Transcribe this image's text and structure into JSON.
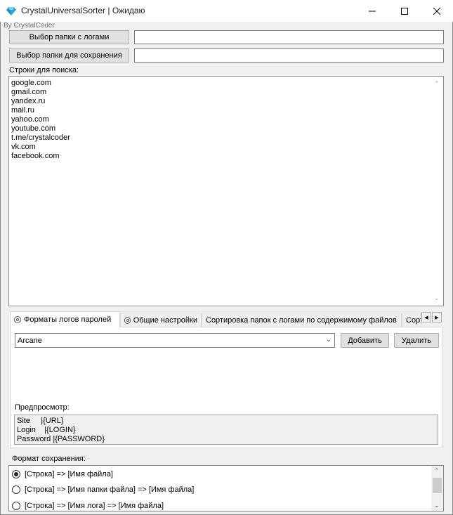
{
  "window": {
    "title": "CrystalUniversalSorter | Ожидаю",
    "minimize_glyph": "—",
    "maximize_glyph": "☐",
    "close_glyph": "✕",
    "icon_color": "#2aa7e0"
  },
  "byline": "By CrystalCoder",
  "folders": {
    "logs_button": "Выбор папки с логами",
    "logs_path": "",
    "save_button": "Выбор папки для сохранения",
    "save_path": ""
  },
  "search": {
    "label": "Строки для поиска:",
    "lines": [
      "google.com",
      "gmail.com",
      "yandex.ru",
      "mail.ru",
      "yahoo.com",
      "youtube.com",
      "t.me/crystalcoder",
      "vk.com",
      "facebook.com"
    ]
  },
  "tabs": {
    "items": [
      {
        "label": "Форматы логов паролей",
        "icon": "gear-icon"
      },
      {
        "label": "Общие настройки",
        "icon": "gear-icon"
      },
      {
        "label": "Сортировка папок с логами по содержимому файлов",
        "icon": ""
      },
      {
        "label": "Сорт",
        "icon": ""
      }
    ],
    "active_index": 0,
    "nav_left": "◀",
    "nav_right": "▶"
  },
  "formats": {
    "selected": "Arcane",
    "add_button": "Добавить",
    "delete_button": "Удалить",
    "preview_label": "Предпросмотр:",
    "preview_lines": [
      "Site     |{URL}",
      "Login    |{LOGIN}",
      "Password |{PASSWORD}"
    ]
  },
  "save_format": {
    "label": "Формат сохранения:",
    "options": [
      {
        "text": "[Строка] => [Имя файла]",
        "checked": true
      },
      {
        "text": "[Строка] => [Имя папки файла] => [Имя файла]",
        "checked": false
      },
      {
        "text": "[Строка] => [Имя лога] => [Имя файла]",
        "checked": false
      }
    ]
  }
}
